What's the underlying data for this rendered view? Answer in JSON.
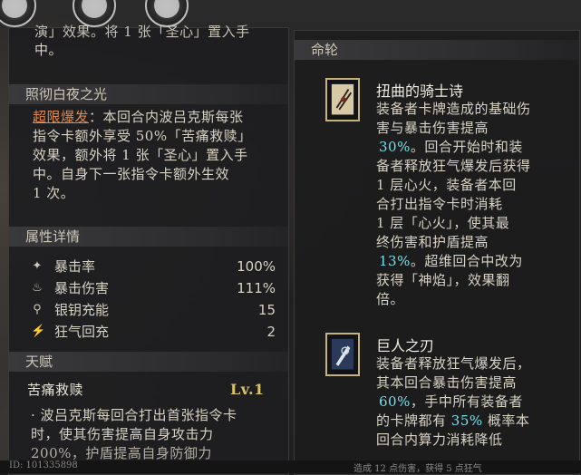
{
  "left": {
    "top_fragment_line1": "演」效果。将 1 张「圣心」置入手",
    "top_fragment_line2": "中。",
    "section1": {
      "title": "照彻白夜之光",
      "keyword": "超限爆发",
      "line1_rest": "：本回合内波吕克斯每张",
      "line2": "指令卡额外享受 50%「苦痛救赎」",
      "line3": "效果，额外将 1 张「圣心」置入手",
      "line4": "中。自身下一张指令卡额外生效",
      "line5": "1 次。"
    },
    "attributes": {
      "title": "属性详情",
      "rows": [
        {
          "icon": "crit-rate-icon",
          "glyph": "✦",
          "label": "暴击率",
          "value": "100%"
        },
        {
          "icon": "crit-damage-icon",
          "glyph": "♨",
          "label": "暴击伤害",
          "value": "111%"
        },
        {
          "icon": "silver-key-icon",
          "glyph": "⚲",
          "label": "银钥充能",
          "value": "15"
        },
        {
          "icon": "rage-icon",
          "glyph": "⚡",
          "label": "狂气回充",
          "value": "2"
        }
      ]
    },
    "talent": {
      "title": "天赋",
      "name": "苦痛救赎",
      "level": "Lv.1",
      "line1": "· 波吕克斯每回合打出首张指令卡",
      "line2": "时，使其伤害提高自身攻击力",
      "line3": "200%，护盾提高自身防御力"
    }
  },
  "right": {
    "title": "命轮",
    "relic1": {
      "name": "扭曲的骑士诗",
      "line1": "装备者卡牌造成的基础伤",
      "line2": "害与暴击伤害提高",
      "v1": "30%",
      "line3_rest": "。回合开始时和装",
      "line4": "备者释放狂气爆发后获得",
      "line5": "1 层心火，装备者本回",
      "line6": "合打出指令卡时消耗",
      "line7": "1 层「心火」，使其最",
      "line8": "终伤害和护盾提高",
      "v2": "13%",
      "line9_rest": "。超维回合中改为",
      "line10": "获得「神焰」，效果翻",
      "line11": "倍。"
    },
    "relic2": {
      "name": "巨人之刃",
      "line1": "装备者释放狂气爆发后，",
      "line2": "其本回合暴击伤害提高",
      "v1": "60%",
      "line3_rest": "，手中所有装备者",
      "line4_pre": "的卡牌都有 ",
      "v2": "35%",
      "line4_rest": " 概率本",
      "line5": "回合内算力消耗降低"
    }
  },
  "footer": {
    "id_text": "ID: 101335898",
    "log_text": "造成 12 点伤害，获得 5 点狂气"
  },
  "colors": {
    "orange": "#e2884a",
    "cyan": "#6fe3ee",
    "gold": "#d8c26a"
  }
}
